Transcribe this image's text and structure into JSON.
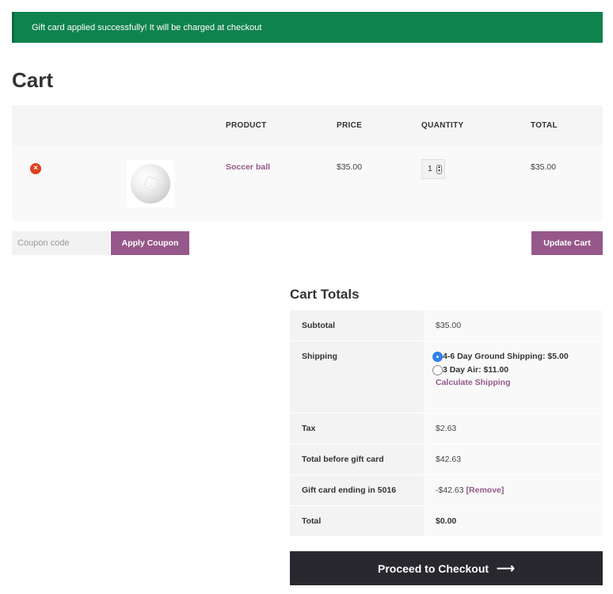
{
  "notice": {
    "message": "Gift card applied successfully! It will be charged at checkout"
  },
  "page": {
    "title": "Cart"
  },
  "cart_table": {
    "headers": {
      "product": "PRODUCT",
      "price": "PRICE",
      "quantity": "QUANTITY",
      "total": "TOTAL"
    },
    "items": [
      {
        "remove_icon": "remove-circle-icon",
        "remove_glyph": "×",
        "thumbnail": "soccer-ball-image",
        "name": "Soccer ball",
        "price": "$35.00",
        "quantity": "1",
        "total": "$35.00"
      }
    ]
  },
  "coupon": {
    "placeholder": "Coupon code",
    "apply_label": "Apply Coupon"
  },
  "update_cart_label": "Update Cart",
  "totals": {
    "title": "Cart Totals",
    "subtotal_label": "Subtotal",
    "subtotal_value": "$35.00",
    "shipping_label": "Shipping",
    "shipping_options": [
      {
        "label": "4-6 Day Ground Shipping: $5.00",
        "selected": true
      },
      {
        "label": "3 Day Air: $11.00",
        "selected": false
      }
    ],
    "calculate_shipping": "Calculate Shipping",
    "tax_label": "Tax",
    "tax_value": "$2.63",
    "before_gift_label": "Total before gift card",
    "before_gift_value": "$42.63",
    "gift_label": "Gift card ending in 5016",
    "gift_value": "-$42.63",
    "gift_remove": "[Remove]",
    "total_label": "Total",
    "total_value": "$0.00"
  },
  "checkout": {
    "label": "Proceed to Checkout",
    "arrow_icon": "arrow-right-icon",
    "arrow_glyph": "⟶"
  },
  "colors": {
    "notice": "#0f834d",
    "accent": "#96588a",
    "checkout": "#28282e",
    "radio_selected": "#2f80ed"
  }
}
